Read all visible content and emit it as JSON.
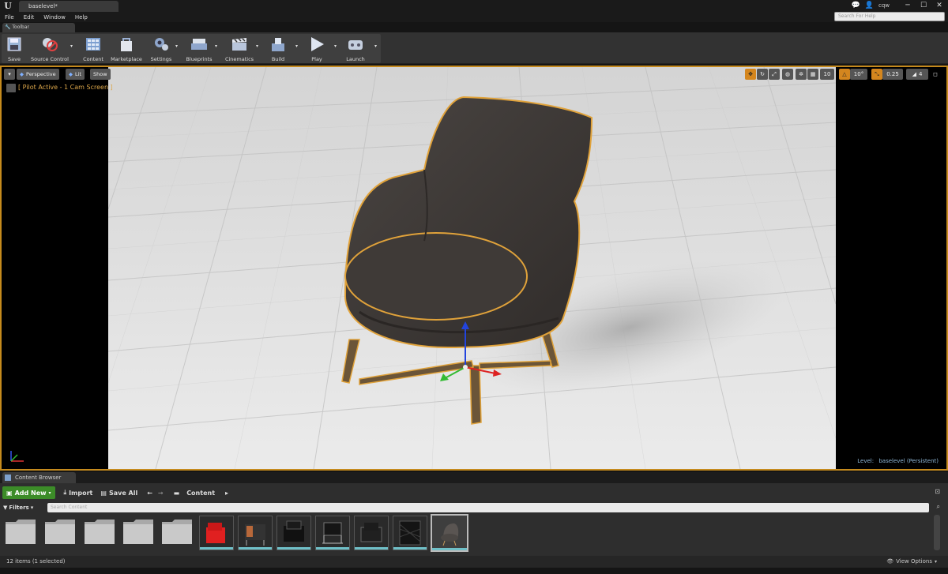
{
  "window": {
    "tab_title": "baselevel*",
    "user": "cqw",
    "search_help_placeholder": "Search For Help",
    "minimize": "─",
    "maximize": "☐",
    "close": "✕"
  },
  "menu": [
    "File",
    "Edit",
    "Window",
    "Help"
  ],
  "toolbar_tab": "Toolbar",
  "toolbar": {
    "buttons": [
      "Save",
      "Source Control",
      "Content",
      "Marketplace",
      "Settings",
      "Blueprints",
      "Cinematics",
      "Build",
      "Play",
      "Launch"
    ]
  },
  "viewport": {
    "perspective": "Perspective",
    "lit": "Lit",
    "show": "Show",
    "pilot_text": "[ Pilot Active - 1 Cam Screen ]",
    "grid_snap": "10",
    "rotation_snap": "10°",
    "scale_snap": "0.25",
    "camera_speed": "4",
    "level_label": "Level:",
    "level_name": "baselevel (Persistent)"
  },
  "content_browser": {
    "tab": "Content Browser",
    "add_new": "Add New",
    "import": "Import",
    "save_all": "Save All",
    "path": "Content",
    "filters": "Filters",
    "search_placeholder": "Search Content",
    "status": "12 items (1 selected)",
    "view_options": "View Options"
  },
  "colors": {
    "selection_outline": "#c58a1d",
    "add_new_green": "#3c8c28",
    "asset_bar": "#6fc0c8"
  }
}
